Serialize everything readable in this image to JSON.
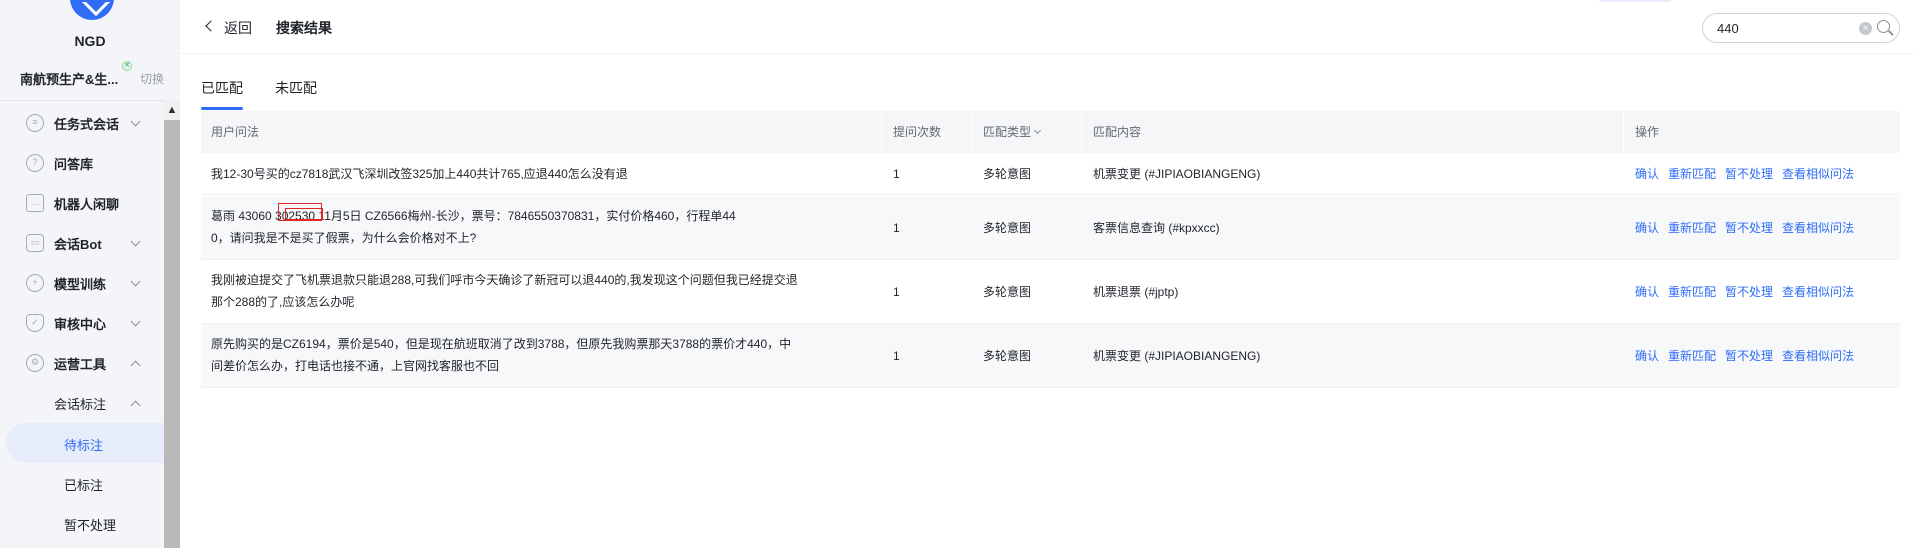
{
  "sidebar": {
    "brand": "NGD",
    "tenant": "南航预生产&生...",
    "switch_label": "切换",
    "items": [
      {
        "label": "任务式会话"
      },
      {
        "label": "问答库"
      },
      {
        "label": "机器人闲聊"
      },
      {
        "label": "会话Bot"
      },
      {
        "label": "模型训练"
      },
      {
        "label": "审核中心"
      },
      {
        "label": "运营工具"
      }
    ],
    "sub_group": "会话标注",
    "leaves": [
      {
        "label": "待标注"
      },
      {
        "label": "已标注"
      },
      {
        "label": "暂不处理"
      }
    ]
  },
  "header": {
    "back_label": "返回",
    "title": "搜索结果",
    "search_value": "440"
  },
  "tabs": [
    {
      "label": "已匹配"
    },
    {
      "label": "未匹配"
    }
  ],
  "table": {
    "columns": [
      "用户问法",
      "提问次数",
      "匹配类型",
      "匹配内容",
      "操作"
    ],
    "actions": [
      "确认",
      "重新匹配",
      "暂不处理",
      "查看相似问法"
    ],
    "rows": [
      {
        "question_l1": "我12-30号买的cz7818武汉飞深圳改签325加上440共计765,应退440怎么没有退",
        "question_l2": "",
        "count": "1",
        "type": "多轮意图",
        "content": "机票变更 (#JIPIAOBIANGENG)"
      },
      {
        "question_l1": "葛雨 43060          302530 11月5日 CZ6566梅州-长沙，票号：7846550370831，实付价格460，行程单44",
        "question_l2": "0，请问我是不是买了假票，为什么会价格对不上?",
        "count": "1",
        "type": "多轮意图",
        "content": "客票信息查询 (#kpxxcc)"
      },
      {
        "question_l1": "我刚被迫提交了飞机票退款只能退288,可我们呼市今天确诊了新冠可以退440的,我发现这个问题但我已经提交退",
        "question_l2": "那个288的了,应该怎么办呢",
        "count": "1",
        "type": "多轮意图",
        "content": "机票退票 (#jptp)"
      },
      {
        "question_l1": "原先购买的是CZ6194，票价是540，但是现在航班取消了改到3788，但原先我购票那天3788的票价才440，中",
        "question_l2": "间差价怎么办，打电话也接不通，上官网找客服也不回",
        "count": "1",
        "type": "多轮意图",
        "content": "机票变更 (#JIPIAOBIANGENG)"
      }
    ]
  }
}
